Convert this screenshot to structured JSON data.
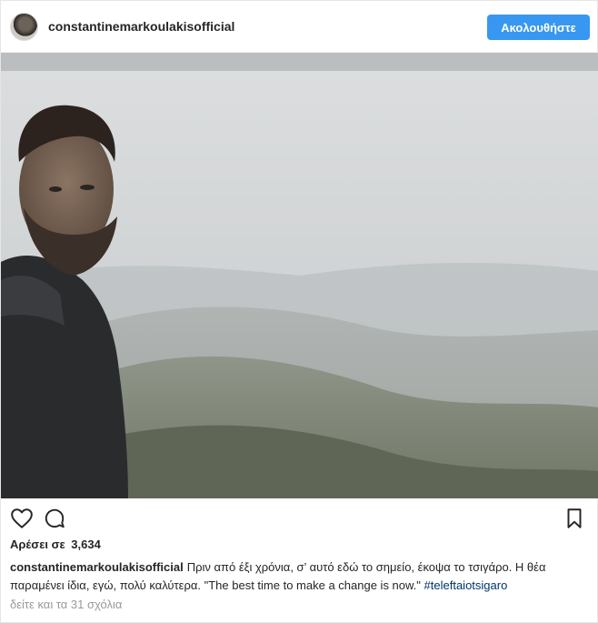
{
  "header": {
    "username": "constantinemarkoulakisofficial",
    "follow_label": "Ακολουθήστε"
  },
  "photo": {
    "icon": "portrait-photo"
  },
  "actions": {
    "like_icon": "heart-icon",
    "comment_icon": "comment-icon",
    "bookmark_icon": "bookmark-icon"
  },
  "likes": {
    "label": "Αρέσει σε",
    "count": "3,634"
  },
  "caption": {
    "username": "constantinemarkoulakisofficial",
    "text": "Πριν από έξι χρόνια, σ’ αυτό εδώ το σημείο, έκοψα το τσιγάρο. Η θέα παραμένει ίδια, εγώ, πολύ καλύτερα. \"The best time to make a change is now.\" ",
    "hashtag": "#teleftaiotsigaro"
  },
  "comments": {
    "view_all": "δείτε και τα 31 σχόλια"
  },
  "colors": {
    "accent": "#3897f0",
    "hashtag": "#003569",
    "muted": "#999999"
  }
}
